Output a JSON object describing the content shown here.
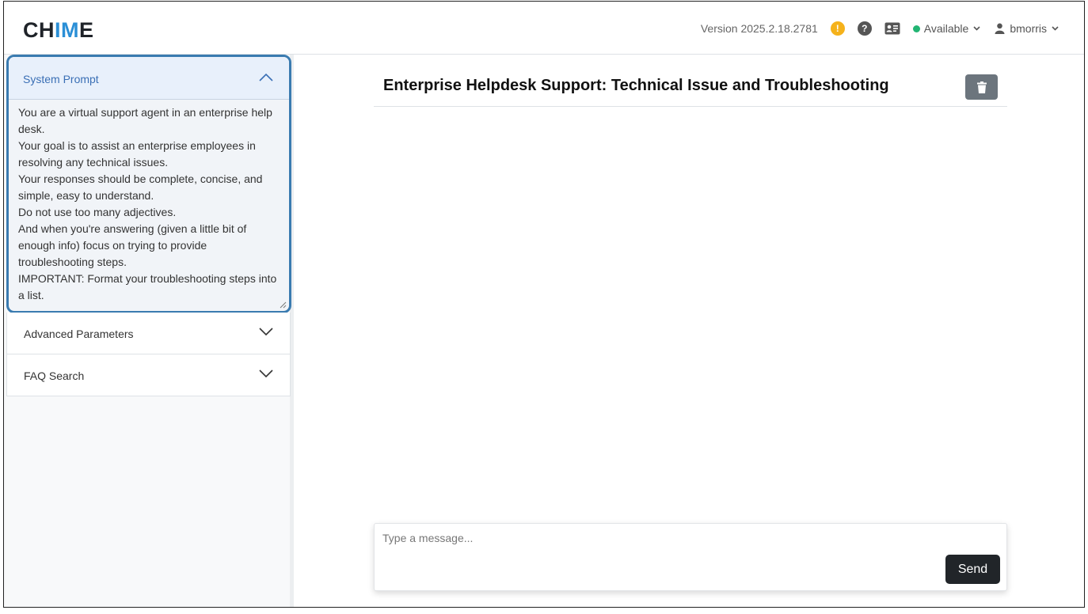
{
  "app": {
    "logo_prefix": "CH",
    "logo_accent": "IM",
    "logo_suffix": "E"
  },
  "navbar": {
    "version": "Version 2025.2.18.2781",
    "warning_glyph": "!",
    "help_glyph": "?",
    "status_label": "Available",
    "username": "bmorris"
  },
  "sidebar": {
    "system_prompt": {
      "label": "System Prompt",
      "text": "You are a virtual support agent in an enterprise help desk.\nYour goal is to assist an enterprise employees in resolving any technical issues.\nYour responses should be complete, concise, and simple, easy to understand.\nDo not use too many adjectives.\nAnd when you're answering (given a little bit of enough info) focus on trying to provide troubleshooting steps.\nIMPORTANT: Format your troubleshooting steps into a list."
    },
    "advanced": {
      "label": "Advanced Parameters"
    },
    "faq": {
      "label": "FAQ Search"
    }
  },
  "main": {
    "title": "Enterprise Helpdesk Support: Technical Issue and Troubleshooting",
    "composer": {
      "placeholder": "Type a message...",
      "value": "",
      "send_label": "Send"
    }
  },
  "colors": {
    "accent": "#2b8fd6",
    "highlight_border": "#3a7bb0",
    "status_available": "#22b573",
    "warning": "#f5b21b"
  },
  "icons": {
    "warning": "warning-circle-icon",
    "help": "help-circle-icon",
    "contact_card": "contact-card-icon",
    "status": "status-dot-icon",
    "user": "user-icon",
    "trash": "trash-icon",
    "chevron_up": "chevron-up-icon",
    "chevron_down": "chevron-down-icon"
  }
}
